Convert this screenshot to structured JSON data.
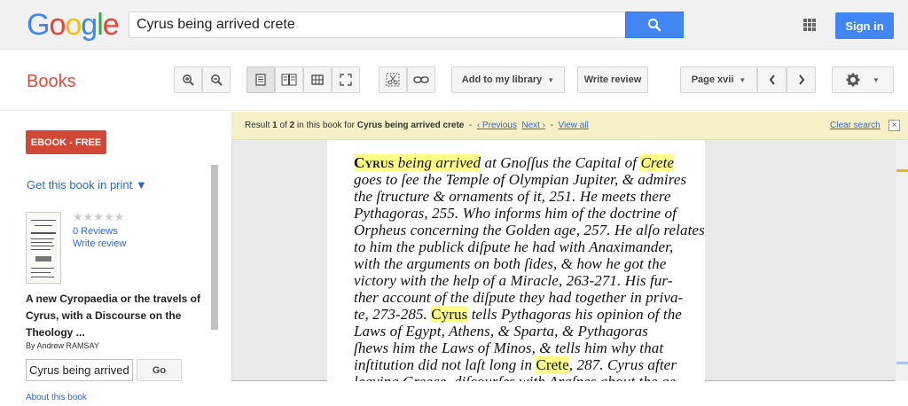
{
  "header": {
    "logo_letters": [
      {
        "ch": "G",
        "color": "#4285f4"
      },
      {
        "ch": "o",
        "color": "#ea4335"
      },
      {
        "ch": "o",
        "color": "#fbbc05"
      },
      {
        "ch": "g",
        "color": "#4285f4"
      },
      {
        "ch": "l",
        "color": "#34a853"
      },
      {
        "ch": "e",
        "color": "#ea4335"
      }
    ],
    "search_value": "Cyrus being arrived crete",
    "search_icon": "search-icon",
    "apps_icon": "apps-grid-icon",
    "signin_label": "Sign in"
  },
  "toolbar": {
    "section_title": "Books",
    "add_library_label": "Add to my library",
    "write_review_label": "Write review",
    "page_label": "Page xvii"
  },
  "sidebar": {
    "ebook_label": "EBOOK - FREE",
    "get_print_label": "Get this book in print ▼",
    "reviews_count": "0 Reviews",
    "write_review_label": "Write review",
    "stars": "★★★★★",
    "book_title": "A new Cyropaedia or the travels of Cyrus, with a Discourse on the Theology ...",
    "author": "By Andrew RAMSAY",
    "search_value": "Cyrus being arrived c",
    "go_label": "Go",
    "about_label": "About this book"
  },
  "result": {
    "prefix": "Result ",
    "current": "1",
    "of": " of ",
    "total": "2",
    "in_book": " in this book for ",
    "query": "Cyrus being arrived crete",
    "sep1": "  -  ",
    "previous_label": "‹ Previous",
    "next_label": "Next ›",
    "sep2": "  -  ",
    "view_all_label": "View all",
    "clear_label": "Clear search",
    "close_label": "×"
  },
  "page_text": {
    "l1a": "Cyrus",
    "l1b": " being arrived",
    "l1c": " at Gnoſſus the Capital of ",
    "l1d": "Crete",
    "l2": "goes to ſee the Temple of Olympian Jupiter, & admires",
    "l3": "the ſtructure & ornaments of it, 251. He meets there",
    "l4": "Pythagoras, 255. Who informs him of the doctrine of",
    "l5": "Orpheus concerning the Golden age, 257. He alſo relates",
    "l6": "to him the publick diſpute he had with Anaximander,",
    "l7": "with the arguments on both ſides, & how he got the",
    "l8": "victory with the help of a Miracle, 263-271. His fur-",
    "l9": "ther account of the diſpute they had together in priva-",
    "l10a": "te, 273-285. ",
    "l10b": "Cyrus",
    "l10c": " tells Pythagoras his opinion of the",
    "l11": "Laws of Egypt, Athens, & Sparta, & Pythagoras",
    "l12": "ſhews him the Laws of Minos, & tells him why that",
    "l13a": "inſtitution did not laſt long in ",
    "l13b": "Crete",
    "l13c": ", 287. Cyrus after",
    "l14": "leaving Greece, diſcourſes with Araſpes about the ge-"
  },
  "colors": {
    "accent_blue": "#4285f4",
    "ebook_red": "#d14836",
    "books_red": "#dd4b39",
    "link_blue": "#3366cc",
    "result_bg": "#f7f0c7",
    "highlight": "#ffff88",
    "scroll_marker_orange": "#f4b400",
    "scroll_marker_blue": "#a8c4f0"
  }
}
